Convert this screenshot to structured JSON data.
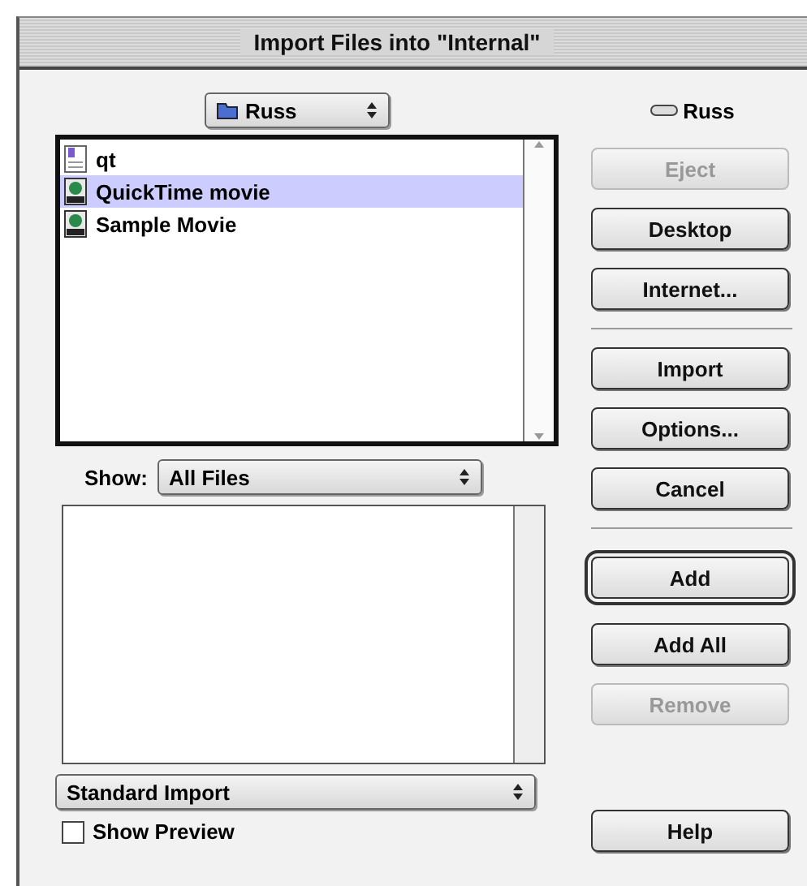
{
  "window": {
    "title": "Import Files into \"Internal\""
  },
  "folder_popup": {
    "label": "Russ"
  },
  "volume": {
    "label": "Russ"
  },
  "files": [
    {
      "name": "qt",
      "kind": "document",
      "selected": false
    },
    {
      "name": "QuickTime movie",
      "kind": "movie",
      "selected": true
    },
    {
      "name": "Sample Movie",
      "kind": "movie",
      "selected": false
    }
  ],
  "show": {
    "label": "Show:",
    "value": "All Files"
  },
  "import_popup": {
    "value": "Standard Import"
  },
  "show_preview": {
    "label": "Show Preview",
    "checked": false
  },
  "button_groups": [
    {
      "buttons": [
        {
          "label": "Eject",
          "disabled": true,
          "default": false
        },
        {
          "label": "Desktop",
          "disabled": false,
          "default": false
        },
        {
          "label": "Internet...",
          "disabled": false,
          "default": false
        }
      ]
    },
    {
      "buttons": [
        {
          "label": "Import",
          "disabled": false,
          "default": false
        },
        {
          "label": "Options...",
          "disabled": false,
          "default": false
        },
        {
          "label": "Cancel",
          "disabled": false,
          "default": false
        }
      ]
    },
    {
      "buttons": [
        {
          "label": "Add",
          "disabled": false,
          "default": true
        },
        {
          "label": "Add All",
          "disabled": false,
          "default": false
        },
        {
          "label": "Remove",
          "disabled": true,
          "default": false
        }
      ]
    },
    {
      "buttons": [
        {
          "label": "Help",
          "disabled": false,
          "default": false
        }
      ]
    }
  ]
}
